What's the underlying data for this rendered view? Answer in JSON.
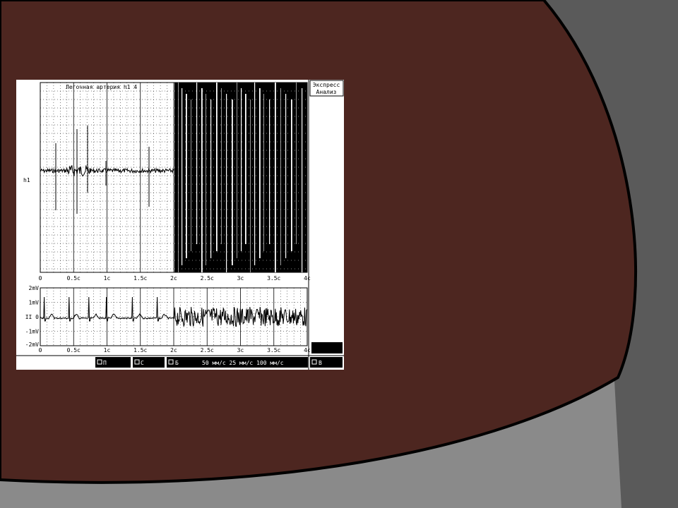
{
  "colors": {
    "slide_background": "#4d2620",
    "slide_border": "#000000",
    "gray_light": "#8a8a8a",
    "gray_dark": "#5a5a5a",
    "screen_bg": "#ffffff",
    "ink": "#000000"
  },
  "top_chart": {
    "title": "Легочная артерия h1  4",
    "channel_label": "h1",
    "x_ticks": [
      "0",
      "0.5с",
      "1с",
      "1.5с",
      "2с",
      "2.5с",
      "3с",
      "3.5с",
      "4с"
    ]
  },
  "bottom_chart": {
    "y_ticks": [
      "2mV",
      "1mV",
      "II 0",
      "-1mV",
      "-2mV"
    ],
    "x_ticks": [
      "0",
      "0.5с",
      "1с",
      "1.5с",
      "2с",
      "2.5с",
      "3с",
      "3.5с",
      "4с"
    ]
  },
  "side_panel": {
    "line1": "Экспресс",
    "line2": "Анализ"
  },
  "status_bar": {
    "p_label": "П",
    "s_label": "С",
    "b_label": "Б",
    "speeds": "50 мм/с 25 мм/с 100 мм/с",
    "v_label": "В"
  }
}
